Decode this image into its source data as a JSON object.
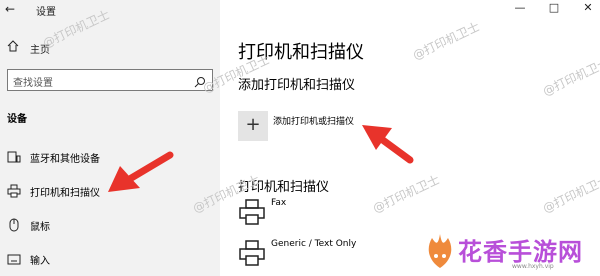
{
  "app_title": "设置",
  "sidebar": {
    "home": "主页",
    "search_placeholder": "查找设置",
    "section": "设备",
    "items": [
      {
        "label": "蓝牙和其他设备"
      },
      {
        "label": "打印机和扫描仪"
      },
      {
        "label": "鼠标"
      },
      {
        "label": "输入"
      }
    ]
  },
  "main": {
    "title": "打印机和扫描仪",
    "add_section": "添加打印机和扫描仪",
    "add_button_label": "添加打印机或扫描仪",
    "printers_section": "打印机和扫描仪",
    "printers": [
      {
        "name": "Fax"
      },
      {
        "name": "Generic / Text Only"
      }
    ]
  },
  "watermark": "@打印机卫士",
  "logo": {
    "text": "花香手游网",
    "sub": "www.hxyh.vip"
  },
  "colors": {
    "arrow": "#e8332b",
    "sidebar_bg": "#f2f2f2",
    "logo": "#b84fd9"
  }
}
